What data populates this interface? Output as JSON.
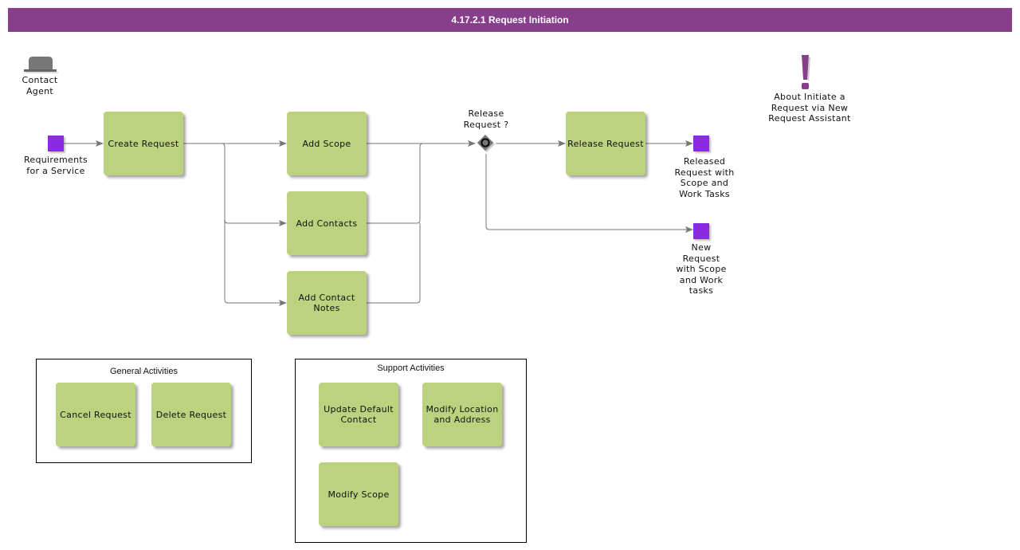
{
  "header": {
    "title": "4.17.2.1 Request Initiation"
  },
  "colors": {
    "header": "#873f8c",
    "task": "#bdd27e",
    "data_object": "#8a2be2",
    "gateway": "#777777"
  },
  "role": {
    "icon": "hat-icon",
    "label_line1": "Contact",
    "label_line2": "Agent"
  },
  "note": {
    "icon": "exclamation-icon",
    "line1": "About Initiate a",
    "line2": "Request via New",
    "line3": "Request Assistant"
  },
  "start_data": {
    "line1": "Requirements",
    "line2": "for a Service"
  },
  "tasks": {
    "create_request": "Create Request",
    "add_scope": "Add Scope",
    "add_contacts": "Add Contacts",
    "add_contact_notes_1": "Add Contact",
    "add_contact_notes_2": "Notes",
    "release_request": "Release Request"
  },
  "gateway": {
    "line1": "Release",
    "line2": "Request ?"
  },
  "outputs": {
    "released": {
      "line1": "Released",
      "line2": "Request with",
      "line3": "Scope and",
      "line4": "Work Tasks"
    },
    "new": {
      "line1": "New",
      "line2": "Request",
      "line3": "with Scope",
      "line4": "and Work",
      "line5": "tasks"
    }
  },
  "general_activities": {
    "title": "General Activities",
    "items": [
      "Cancel Request",
      "Delete Request"
    ]
  },
  "support_activities": {
    "title": "Support Activities",
    "update_default_contact_1": "Update Default",
    "update_default_contact_2": "Contact",
    "modify_location_1": "Modify Location",
    "modify_location_2": "and Address",
    "modify_scope": "Modify Scope"
  }
}
